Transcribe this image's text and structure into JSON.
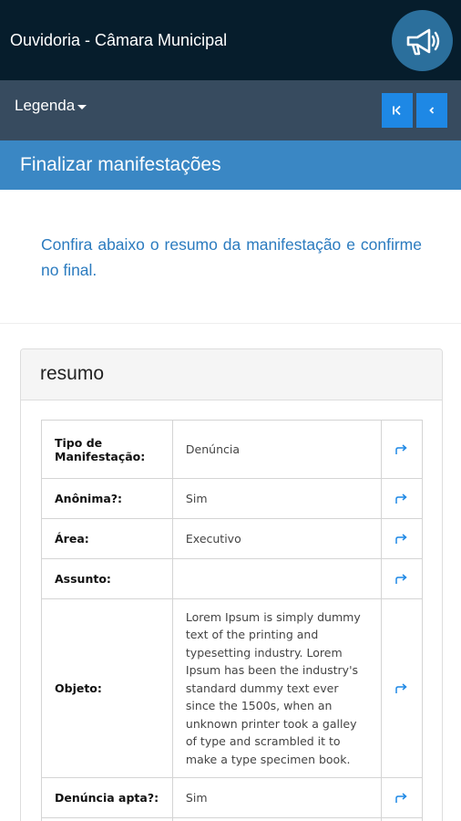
{
  "header": {
    "title": "Ouvidoria - Câmara Municipal",
    "megaphone_icon": "megaphone-icon"
  },
  "navbar": {
    "legend_label": "Legenda",
    "first_icon": "skip-first-icon",
    "prev_icon": "chevron-left-icon"
  },
  "page": {
    "title": "Finalizar manifestações"
  },
  "intro": {
    "text": "Confira abaixo o resumo da manifestação e confirme no final."
  },
  "summary": {
    "title": "resumo",
    "rows": [
      {
        "label": "Tipo de Manifestação:",
        "value": "Denúncia"
      },
      {
        "label": "Anônima?:",
        "value": "Sim"
      },
      {
        "label": "Área:",
        "value": "Executivo"
      },
      {
        "label": "Assunto:",
        "value": ""
      },
      {
        "label": "Objeto:",
        "value": "Lorem Ipsum is simply dummy text of the printing and typesetting industry. Lorem Ipsum has been the industry's standard dummy text ever since the 1500s, when an unknown printer took a galley of type and scrambled it to make a type specimen book."
      },
      {
        "label": "Denúncia apta?:",
        "value": "Sim"
      }
    ]
  },
  "colors": {
    "topbar": "#061d2c",
    "navbar": "#374b5f",
    "header": "#3a87c4",
    "accent": "#1e88e5",
    "intro_text": "#2b7bbf"
  }
}
